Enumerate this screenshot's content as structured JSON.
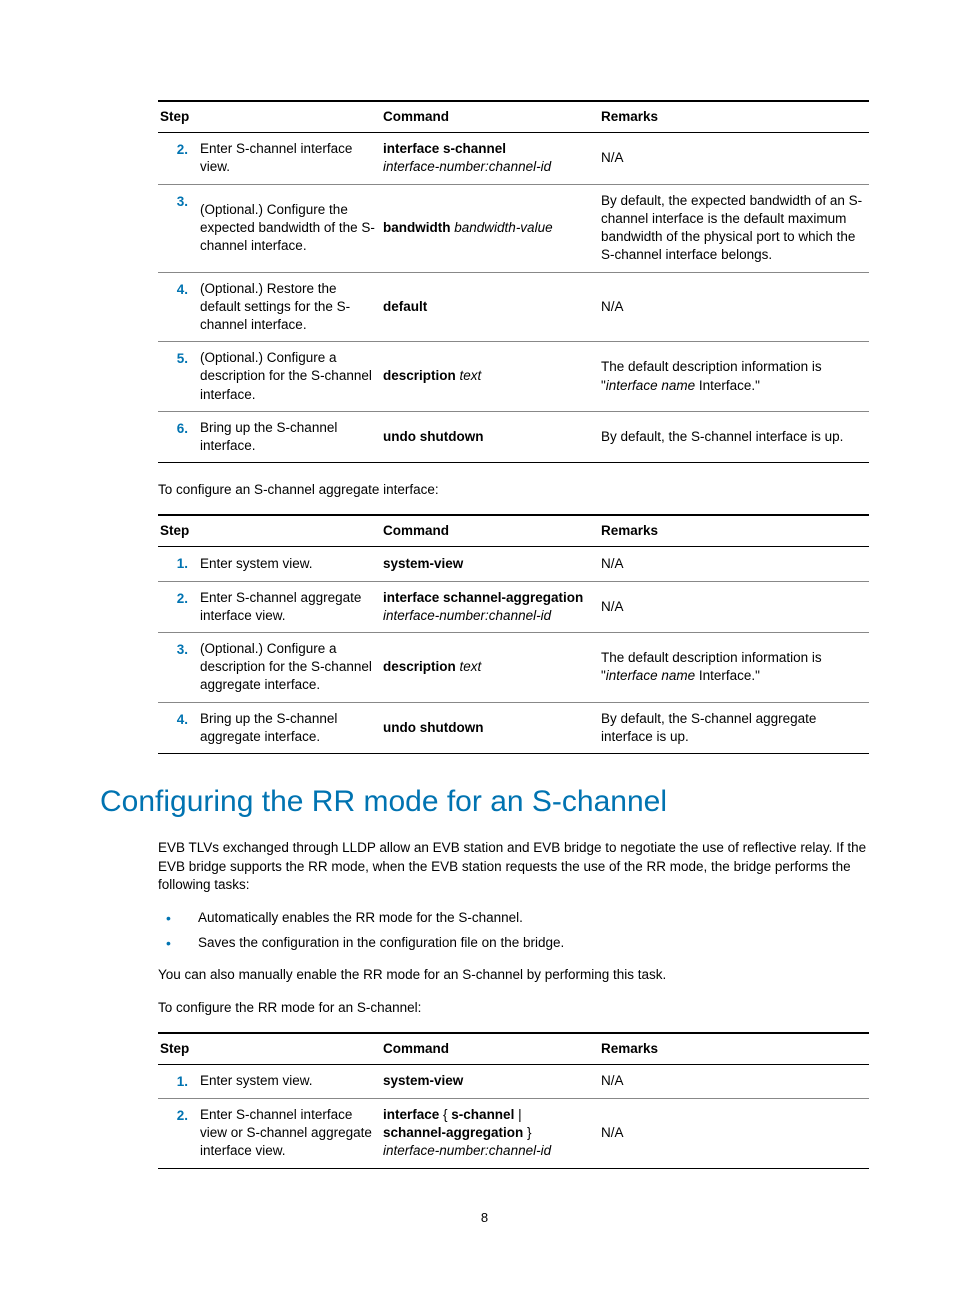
{
  "tables": {
    "headers": {
      "step": "Step",
      "command": "Command",
      "remarks": "Remarks"
    },
    "t1": [
      {
        "num": "2.",
        "desc": "Enter S-channel interface view.",
        "cmd_bold": "interface s-channel",
        "cmd_italic": "interface-number:channel-id",
        "remarks_plain": "N/A"
      },
      {
        "num": "3.",
        "desc": "(Optional.) Configure the expected bandwidth of the S-channel interface.",
        "cmd_bold_inline": "bandwidth",
        "cmd_italic_inline": "bandwidth-value",
        "remarks_plain": "By default, the expected bandwidth of an S-channel interface is the default maximum bandwidth of the physical port to which the S-channel interface belongs."
      },
      {
        "num": "4.",
        "desc": "(Optional.) Restore the default settings for the S-channel interface.",
        "cmd_bold": "default",
        "remarks_plain": "N/A"
      },
      {
        "num": "5.",
        "desc": "(Optional.) Configure a description for the S-channel interface.",
        "cmd_bold_inline": "description",
        "cmd_italic_inline": "text",
        "remarks_pre": "The default description information is \"",
        "remarks_italic": "interface name",
        "remarks_post": " Interface.\""
      },
      {
        "num": "6.",
        "desc": "Bring up the S-channel interface.",
        "cmd_bold": "undo shutdown",
        "remarks_plain": "By default, the S-channel interface is up."
      }
    ],
    "t2_intro": "To configure an S-channel aggregate interface:",
    "t2": [
      {
        "num": "1.",
        "desc": "Enter system view.",
        "cmd_bold": "system-view",
        "remarks_plain": "N/A"
      },
      {
        "num": "2.",
        "desc": "Enter S-channel aggregate interface view.",
        "cmd_bold": "interface schannel-aggregation",
        "cmd_italic": "interface-number:channel-id",
        "remarks_plain": "N/A"
      },
      {
        "num": "3.",
        "desc": "(Optional.) Configure a description for the S-channel aggregate interface.",
        "cmd_bold_inline": "description",
        "cmd_italic_inline": "text",
        "remarks_pre": "The default description information is \"",
        "remarks_italic": "interface name",
        "remarks_post": " Interface.\""
      },
      {
        "num": "4.",
        "desc": "Bring up the S-channel aggregate interface.",
        "cmd_bold": "undo shutdown",
        "remarks_plain": "By default, the S-channel aggregate interface is up."
      }
    ],
    "t3": [
      {
        "num": "1.",
        "desc": "Enter system view.",
        "cmd_bold": "system-view",
        "remarks_plain": "N/A"
      },
      {
        "num": "2.",
        "desc": "Enter S-channel interface view or S-channel aggregate interface view.",
        "cmd_complex": true,
        "remarks_plain": "N/A"
      }
    ],
    "t3_cmd2": {
      "p1": "interface",
      "p2": " { ",
      "p3": "s-channel",
      "p4": " | ",
      "p5": "schannel-aggregation",
      "p6": " } ",
      "p7": "interface-number:channel-id"
    }
  },
  "section": {
    "heading": "Configuring the RR mode for an S-channel",
    "para1": "EVB TLVs exchanged through LLDP allow an EVB station and EVB bridge to negotiate the use of reflective relay. If the EVB bridge supports the RR mode, when the EVB station requests the use of the RR mode, the bridge performs the following tasks:",
    "bullets": [
      "Automatically enables the RR mode for the S-channel.",
      "Saves the configuration in the configuration file on the bridge."
    ],
    "para2": "You can also manually enable the RR mode for an S-channel by performing this task.",
    "para3": "To configure the RR mode for an S-channel:"
  },
  "page_number": "8"
}
